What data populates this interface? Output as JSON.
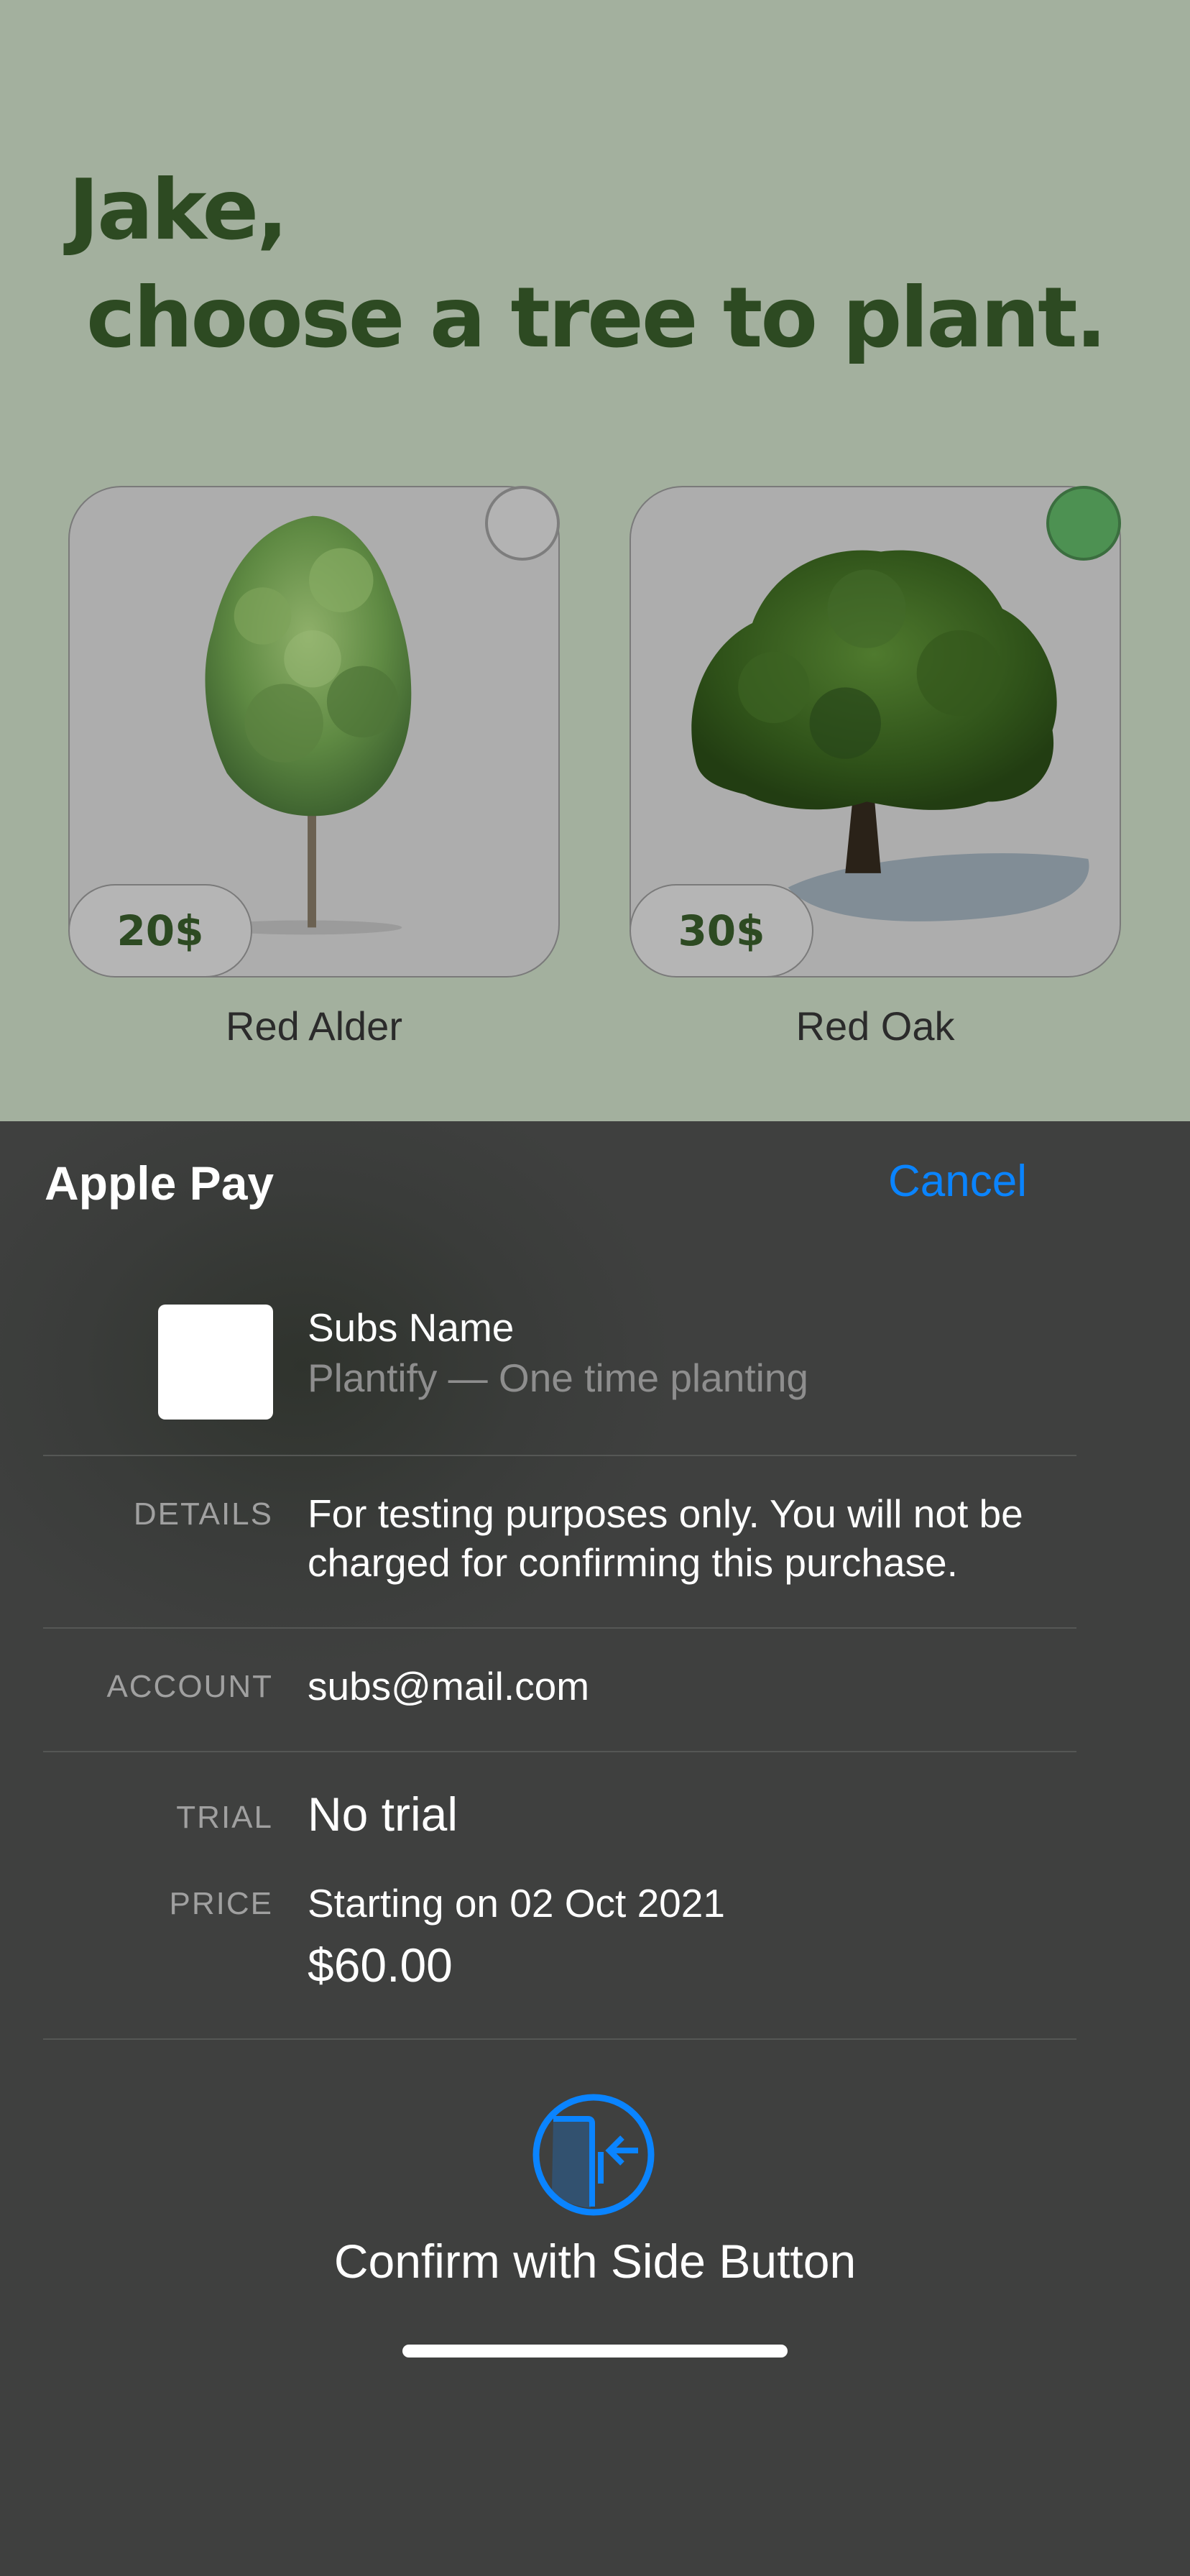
{
  "header": {
    "greeting_line1": "Jake,",
    "greeting_line2": "choose a tree to plant."
  },
  "trees": [
    {
      "name": "Red Alder",
      "price": "20$",
      "selected": false
    },
    {
      "name": "Red Oak",
      "price": "30$",
      "selected": true
    }
  ],
  "colors": {
    "background": "#a3b09e",
    "heading": "#2d4a22",
    "selected_radio": "#4d9152",
    "accent_blue": "#0a84ff",
    "sheet_background": "#3f403f"
  },
  "apple_pay": {
    "title": "Apple Pay",
    "cancel_label": "Cancel",
    "merchant_name": "Subs Name",
    "merchant_description": "Plantify — One time planting",
    "details_label": "DETAILS",
    "details_text": "For testing purposes only. You will not be charged for confirming this purchase.",
    "account_label": "ACCOUNT",
    "account_value": "subs@mail.com",
    "trial_label": "TRIAL",
    "trial_value": "No trial",
    "price_label": "PRICE",
    "price_start": "Starting on 02 Oct 2021",
    "price_amount": "$60.00",
    "confirm_text": "Confirm with Side Button",
    "confirm_icon": "side-button-icon"
  }
}
